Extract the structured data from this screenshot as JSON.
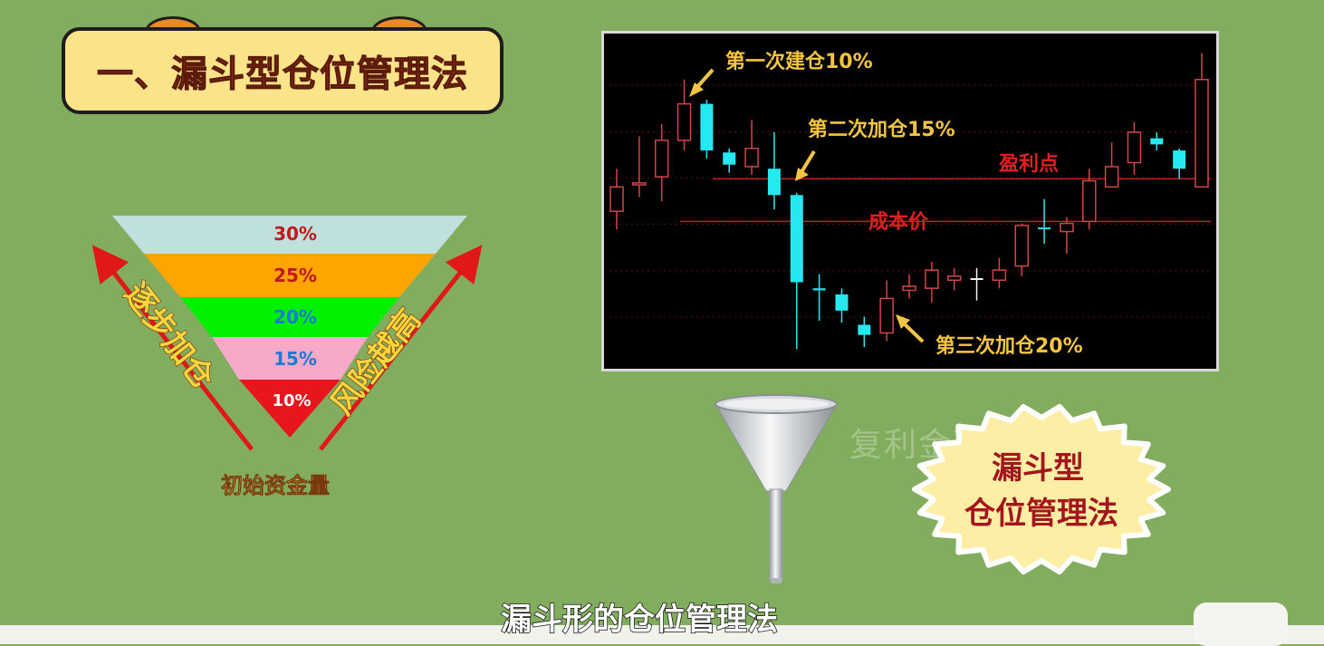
{
  "title": "一、漏斗型仓位管理法",
  "funnel": {
    "levels": [
      {
        "label": "30%",
        "color": "#bfe0dc",
        "text_color": "#c0181c"
      },
      {
        "label": "25%",
        "color": "#ffa500",
        "text_color": "#c0181c"
      },
      {
        "label": "20%",
        "color": "#00f000",
        "text_color": "#1a7ad6"
      },
      {
        "label": "15%",
        "color": "#f7a9c9",
        "text_color": "#1a7ad6"
      },
      {
        "label": "10%",
        "color": "#e8141e",
        "text_color": "#ffffff"
      }
    ],
    "left_label": "逐步加仓",
    "right_label": "风险越高",
    "bottom_label": "初始资金量"
  },
  "chart": {
    "annotations": {
      "first": "第一次建仓10%",
      "second": "第二次加仓15%",
      "third": "第三次加仓20%",
      "profit_point": "盈利点",
      "cost_price": "成本价"
    }
  },
  "chart_data": {
    "type": "candlestick",
    "y_unit": "relative",
    "candles": [
      {
        "o": 45,
        "c": 57,
        "h": 66,
        "l": 36,
        "color": "red"
      },
      {
        "o": 58,
        "c": 59,
        "h": 82,
        "l": 52,
        "color": "red"
      },
      {
        "o": 62,
        "c": 80,
        "h": 88,
        "l": 50,
        "color": "red"
      },
      {
        "o": 80,
        "c": 98,
        "h": 110,
        "l": 75,
        "color": "red"
      },
      {
        "o": 98,
        "c": 75,
        "h": 100,
        "l": 71,
        "color": "cyan"
      },
      {
        "o": 74,
        "c": 68,
        "h": 76,
        "l": 64,
        "color": "cyan"
      },
      {
        "o": 67,
        "c": 76,
        "h": 90,
        "l": 63,
        "color": "red"
      },
      {
        "o": 66,
        "c": 53,
        "h": 84,
        "l": 46,
        "color": "cyan"
      },
      {
        "o": 53,
        "c": 10,
        "h": 54,
        "l": -23,
        "color": "cyan"
      },
      {
        "o": 7,
        "c": 6,
        "h": 14,
        "l": -9,
        "color": "cyan"
      },
      {
        "o": 4,
        "c": -4,
        "h": 7,
        "l": -10,
        "color": "cyan"
      },
      {
        "o": -11,
        "c": -16,
        "h": -7,
        "l": -22,
        "color": "cyan"
      },
      {
        "o": -15,
        "c": 2,
        "h": 11,
        "l": -19,
        "color": "red"
      },
      {
        "o": 6,
        "c": 8,
        "h": 14,
        "l": 2,
        "color": "red"
      },
      {
        "o": 7,
        "c": 16,
        "h": 20,
        "l": 0,
        "color": "red"
      },
      {
        "o": 11,
        "c": 13,
        "h": 17,
        "l": 6,
        "color": "red"
      },
      {
        "o": 12,
        "c": 12,
        "h": 17,
        "l": 1,
        "color": "white"
      },
      {
        "o": 11,
        "c": 16,
        "h": 22,
        "l": 7,
        "color": "red"
      },
      {
        "o": 18,
        "c": 38,
        "h": 39,
        "l": 13,
        "color": "red"
      },
      {
        "o": 37,
        "c": 37,
        "h": 51,
        "l": 29,
        "color": "cyan"
      },
      {
        "o": 35,
        "c": 39,
        "h": 42,
        "l": 24,
        "color": "red"
      },
      {
        "o": 40,
        "c": 60,
        "h": 66,
        "l": 36,
        "color": "red"
      },
      {
        "o": 57,
        "c": 67,
        "h": 79,
        "l": 57,
        "color": "red"
      },
      {
        "o": 69,
        "c": 84,
        "h": 89,
        "l": 63,
        "color": "red"
      },
      {
        "o": 81,
        "c": 78,
        "h": 84,
        "l": 75,
        "color": "cyan"
      },
      {
        "o": 75,
        "c": 66,
        "h": 76,
        "l": 61,
        "color": "cyan"
      },
      {
        "o": 57,
        "c": 110,
        "h": 123,
        "l": 57,
        "color": "red"
      }
    ],
    "lines": [
      {
        "name": "盈利点",
        "y": 61
      },
      {
        "name": "成本价",
        "y": 40
      }
    ],
    "ylim": [
      -30,
      130
    ]
  },
  "funnel_icon": "funnel-icon",
  "badge": "漏斗型\n仓位管理法",
  "badge_lines": [
    "漏斗型",
    "仓位管理法"
  ],
  "watermark": "复利金理财",
  "subtitle": "漏斗形的仓位管理法"
}
